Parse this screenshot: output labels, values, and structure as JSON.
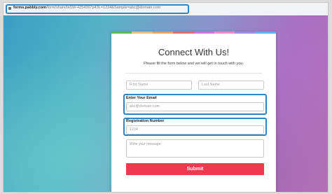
{
  "browser": {
    "url_host": "forms.pabbly.com",
    "url_path": "/form/share/laSW-4254367p43L=1234&Sample=abc@domain.com"
  },
  "form": {
    "stripe_colors": [
      "#5cb85c",
      "#e5c07b",
      "#f0a35e",
      "#e06c75",
      "#c678dd",
      "#e88fc5",
      "#9b8de6",
      "#61afef"
    ],
    "title": "Connect With Us!",
    "subtitle": "Please fill the form below and we will get in touch with you.",
    "first_name_placeholder": "First Name",
    "last_name_placeholder": "Last Name",
    "email_label": "Enter Your Email",
    "email_value": "abc@domain.com",
    "registration_label": "Registration Number",
    "registration_value": "1234",
    "message_placeholder": "Write your message",
    "submit_label": "Submit",
    "accent_color": "#f0394f",
    "highlight_color": "#2a86c7"
  }
}
